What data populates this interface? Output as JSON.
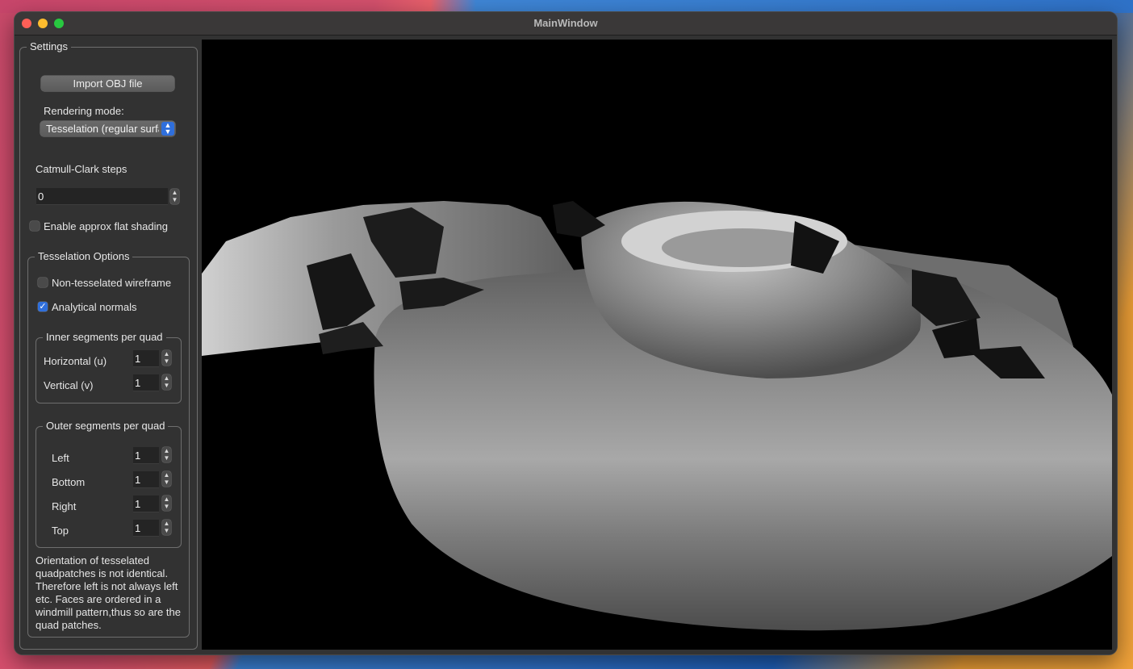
{
  "window": {
    "title": "MainWindow"
  },
  "settings": {
    "group_title": "Settings",
    "import_button": "Import OBJ file",
    "rendering_mode_label": "Rendering mode:",
    "rendering_mode_value": "Tesselation (regular surface)",
    "catmull_clark_label": "Catmull-Clark steps",
    "catmull_clark_value": "0",
    "flat_shading_label": "Enable approx flat shading",
    "flat_shading_checked": false
  },
  "tesselation": {
    "group_title": "Tesselation Options",
    "wireframe_label": "Non-tesselated wireframe",
    "wireframe_checked": false,
    "analytical_label": "Analytical normals",
    "analytical_checked": true,
    "inner": {
      "group_title": "Inner segments per quad",
      "horizontal_label": "Horizontal  (u)",
      "horizontal_value": "1",
      "vertical_label": "Vertical     (v)",
      "vertical_value": "1"
    },
    "outer": {
      "group_title": "Outer segments per quad",
      "left_label": "Left",
      "left_value": "1",
      "bottom_label": "Bottom",
      "bottom_value": "1",
      "right_label": "Right",
      "right_value": "1",
      "top_label": "Top",
      "top_value": "1"
    },
    "note": "Orientation of tesselated quadpatches is not identical. Therefore left is not always left etc. Faces are ordered in a windmill pattern,thus so are the quad patches."
  },
  "viewport": {
    "background": "#000000",
    "model_color": "#9a9a9a"
  }
}
